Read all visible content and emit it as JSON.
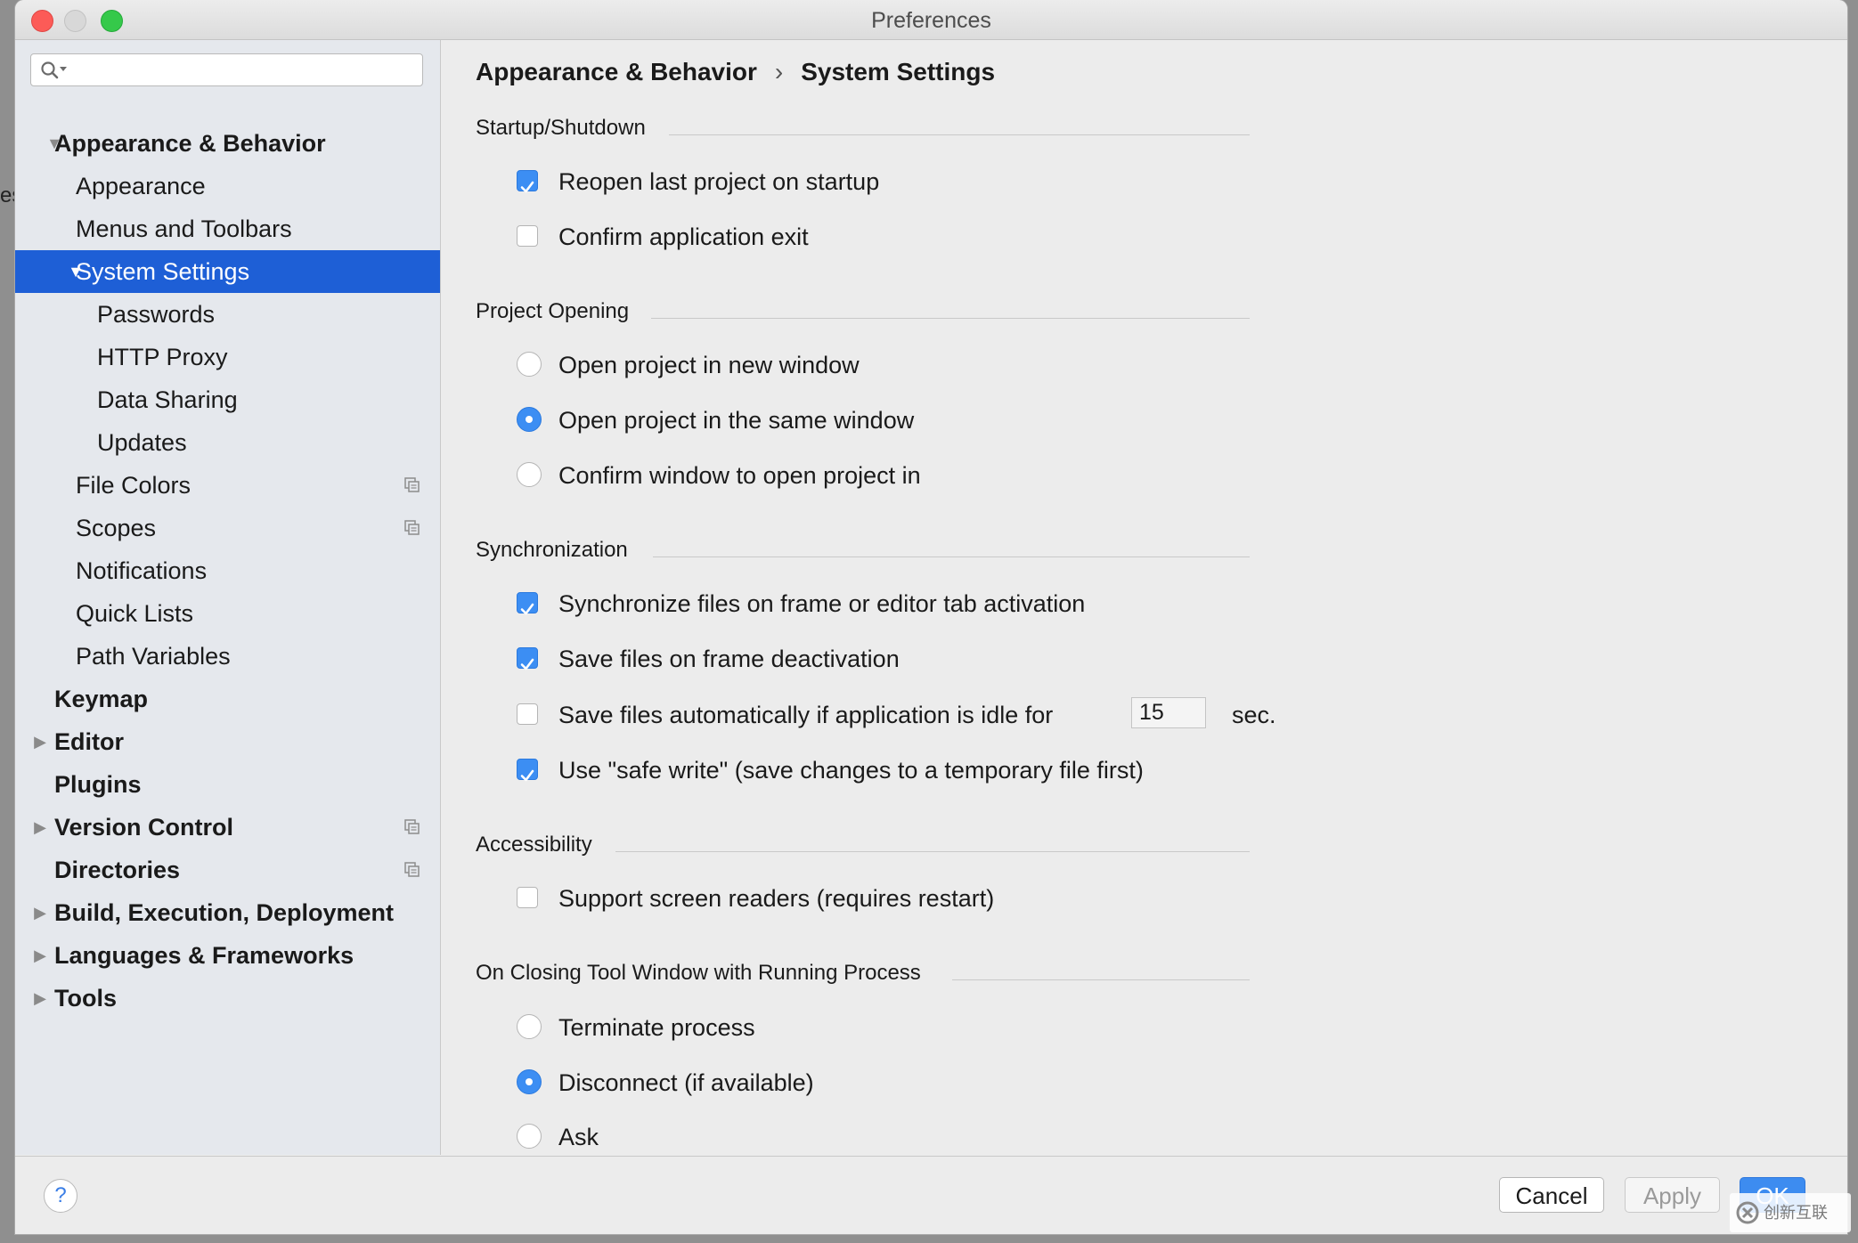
{
  "window": {
    "title": "Preferences"
  },
  "desktop_fragment": "es",
  "search": {
    "value": "",
    "placeholder": ""
  },
  "tree": {
    "items": [
      {
        "label": "Appearance & Behavior",
        "expanded": true
      },
      {
        "label": "Appearance"
      },
      {
        "label": "Menus and Toolbars"
      },
      {
        "label": "System Settings",
        "selected": true,
        "expanded": true
      },
      {
        "label": "Passwords"
      },
      {
        "label": "HTTP Proxy"
      },
      {
        "label": "Data Sharing"
      },
      {
        "label": "Updates"
      },
      {
        "label": "File Colors",
        "icon": "copy-icon"
      },
      {
        "label": "Scopes",
        "icon": "copy-icon"
      },
      {
        "label": "Notifications"
      },
      {
        "label": "Quick Lists"
      },
      {
        "label": "Path Variables"
      },
      {
        "label": "Keymap"
      },
      {
        "label": "Editor",
        "expanded": false
      },
      {
        "label": "Plugins"
      },
      {
        "label": "Version Control",
        "expanded": false,
        "icon": "copy-icon"
      },
      {
        "label": "Directories",
        "icon": "copy-icon"
      },
      {
        "label": "Build, Execution, Deployment",
        "expanded": false
      },
      {
        "label": "Languages & Frameworks",
        "expanded": false
      },
      {
        "label": "Tools",
        "expanded": false
      }
    ]
  },
  "breadcrumb": {
    "parent": "Appearance & Behavior",
    "separator": "›",
    "current": "System Settings"
  },
  "sections": {
    "startup": {
      "title": "Startup/Shutdown",
      "reopen_last_project": {
        "label": "Reopen last project on startup",
        "checked": true
      },
      "confirm_exit": {
        "label": "Confirm application exit",
        "checked": false
      }
    },
    "project_opening": {
      "title": "Project Opening",
      "new_window": {
        "label": "Open project in new window",
        "selected": false
      },
      "same_window": {
        "label": "Open project in the same window",
        "selected": true
      },
      "confirm_window": {
        "label": "Confirm window to open project in",
        "selected": false
      }
    },
    "synchronization": {
      "title": "Synchronization",
      "sync_on_activation": {
        "label": "Synchronize files on frame or editor tab activation",
        "checked": true
      },
      "save_on_deactivation": {
        "label": "Save files on frame deactivation",
        "checked": true
      },
      "save_when_idle": {
        "label": "Save files automatically if application is idle for",
        "checked": false,
        "value": "15",
        "unit": "sec."
      },
      "safe_write": {
        "label": "Use \"safe write\" (save changes to a temporary file first)",
        "checked": true
      }
    },
    "accessibility": {
      "title": "Accessibility",
      "screen_readers": {
        "label": "Support screen readers (requires restart)",
        "checked": false
      }
    },
    "closing_tool_window": {
      "title": "On Closing Tool Window with Running Process",
      "terminate": {
        "label": "Terminate process",
        "selected": false
      },
      "disconnect": {
        "label": "Disconnect (if available)",
        "selected": true
      },
      "ask": {
        "label": "Ask",
        "selected": false
      }
    }
  },
  "footer": {
    "help_label": "?",
    "cancel_label": "Cancel",
    "apply_label": "Apply",
    "ok_label": "OK"
  },
  "watermark": {
    "text": "创新互联"
  },
  "colors": {
    "selection": "#1e5fd6",
    "accent": "#3c8ef3",
    "sidebar_bg": "#e5e8ed",
    "content_bg": "#ececec"
  }
}
